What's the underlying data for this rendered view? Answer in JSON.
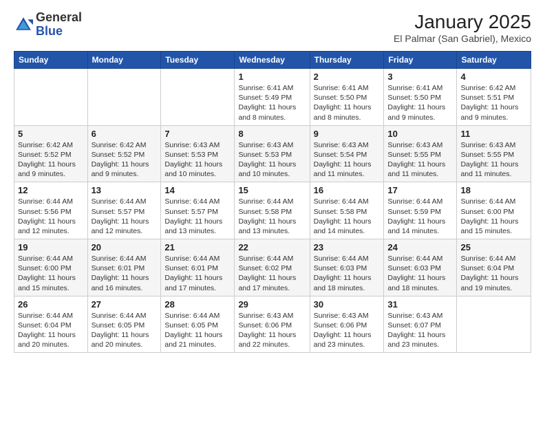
{
  "header": {
    "logo_general": "General",
    "logo_blue": "Blue",
    "month": "January 2025",
    "location": "El Palmar (San Gabriel), Mexico"
  },
  "weekdays": [
    "Sunday",
    "Monday",
    "Tuesday",
    "Wednesday",
    "Thursday",
    "Friday",
    "Saturday"
  ],
  "weeks": [
    [
      {
        "day": "",
        "info": ""
      },
      {
        "day": "",
        "info": ""
      },
      {
        "day": "",
        "info": ""
      },
      {
        "day": "1",
        "info": "Sunrise: 6:41 AM\nSunset: 5:49 PM\nDaylight: 11 hours and 8 minutes."
      },
      {
        "day": "2",
        "info": "Sunrise: 6:41 AM\nSunset: 5:50 PM\nDaylight: 11 hours and 8 minutes."
      },
      {
        "day": "3",
        "info": "Sunrise: 6:41 AM\nSunset: 5:50 PM\nDaylight: 11 hours and 9 minutes."
      },
      {
        "day": "4",
        "info": "Sunrise: 6:42 AM\nSunset: 5:51 PM\nDaylight: 11 hours and 9 minutes."
      }
    ],
    [
      {
        "day": "5",
        "info": "Sunrise: 6:42 AM\nSunset: 5:52 PM\nDaylight: 11 hours and 9 minutes."
      },
      {
        "day": "6",
        "info": "Sunrise: 6:42 AM\nSunset: 5:52 PM\nDaylight: 11 hours and 9 minutes."
      },
      {
        "day": "7",
        "info": "Sunrise: 6:43 AM\nSunset: 5:53 PM\nDaylight: 11 hours and 10 minutes."
      },
      {
        "day": "8",
        "info": "Sunrise: 6:43 AM\nSunset: 5:53 PM\nDaylight: 11 hours and 10 minutes."
      },
      {
        "day": "9",
        "info": "Sunrise: 6:43 AM\nSunset: 5:54 PM\nDaylight: 11 hours and 11 minutes."
      },
      {
        "day": "10",
        "info": "Sunrise: 6:43 AM\nSunset: 5:55 PM\nDaylight: 11 hours and 11 minutes."
      },
      {
        "day": "11",
        "info": "Sunrise: 6:43 AM\nSunset: 5:55 PM\nDaylight: 11 hours and 11 minutes."
      }
    ],
    [
      {
        "day": "12",
        "info": "Sunrise: 6:44 AM\nSunset: 5:56 PM\nDaylight: 11 hours and 12 minutes."
      },
      {
        "day": "13",
        "info": "Sunrise: 6:44 AM\nSunset: 5:57 PM\nDaylight: 11 hours and 12 minutes."
      },
      {
        "day": "14",
        "info": "Sunrise: 6:44 AM\nSunset: 5:57 PM\nDaylight: 11 hours and 13 minutes."
      },
      {
        "day": "15",
        "info": "Sunrise: 6:44 AM\nSunset: 5:58 PM\nDaylight: 11 hours and 13 minutes."
      },
      {
        "day": "16",
        "info": "Sunrise: 6:44 AM\nSunset: 5:58 PM\nDaylight: 11 hours and 14 minutes."
      },
      {
        "day": "17",
        "info": "Sunrise: 6:44 AM\nSunset: 5:59 PM\nDaylight: 11 hours and 14 minutes."
      },
      {
        "day": "18",
        "info": "Sunrise: 6:44 AM\nSunset: 6:00 PM\nDaylight: 11 hours and 15 minutes."
      }
    ],
    [
      {
        "day": "19",
        "info": "Sunrise: 6:44 AM\nSunset: 6:00 PM\nDaylight: 11 hours and 15 minutes."
      },
      {
        "day": "20",
        "info": "Sunrise: 6:44 AM\nSunset: 6:01 PM\nDaylight: 11 hours and 16 minutes."
      },
      {
        "day": "21",
        "info": "Sunrise: 6:44 AM\nSunset: 6:01 PM\nDaylight: 11 hours and 17 minutes."
      },
      {
        "day": "22",
        "info": "Sunrise: 6:44 AM\nSunset: 6:02 PM\nDaylight: 11 hours and 17 minutes."
      },
      {
        "day": "23",
        "info": "Sunrise: 6:44 AM\nSunset: 6:03 PM\nDaylight: 11 hours and 18 minutes."
      },
      {
        "day": "24",
        "info": "Sunrise: 6:44 AM\nSunset: 6:03 PM\nDaylight: 11 hours and 18 minutes."
      },
      {
        "day": "25",
        "info": "Sunrise: 6:44 AM\nSunset: 6:04 PM\nDaylight: 11 hours and 19 minutes."
      }
    ],
    [
      {
        "day": "26",
        "info": "Sunrise: 6:44 AM\nSunset: 6:04 PM\nDaylight: 11 hours and 20 minutes."
      },
      {
        "day": "27",
        "info": "Sunrise: 6:44 AM\nSunset: 6:05 PM\nDaylight: 11 hours and 20 minutes."
      },
      {
        "day": "28",
        "info": "Sunrise: 6:44 AM\nSunset: 6:05 PM\nDaylight: 11 hours and 21 minutes."
      },
      {
        "day": "29",
        "info": "Sunrise: 6:43 AM\nSunset: 6:06 PM\nDaylight: 11 hours and 22 minutes."
      },
      {
        "day": "30",
        "info": "Sunrise: 6:43 AM\nSunset: 6:06 PM\nDaylight: 11 hours and 23 minutes."
      },
      {
        "day": "31",
        "info": "Sunrise: 6:43 AM\nSunset: 6:07 PM\nDaylight: 11 hours and 23 minutes."
      },
      {
        "day": "",
        "info": ""
      }
    ]
  ]
}
